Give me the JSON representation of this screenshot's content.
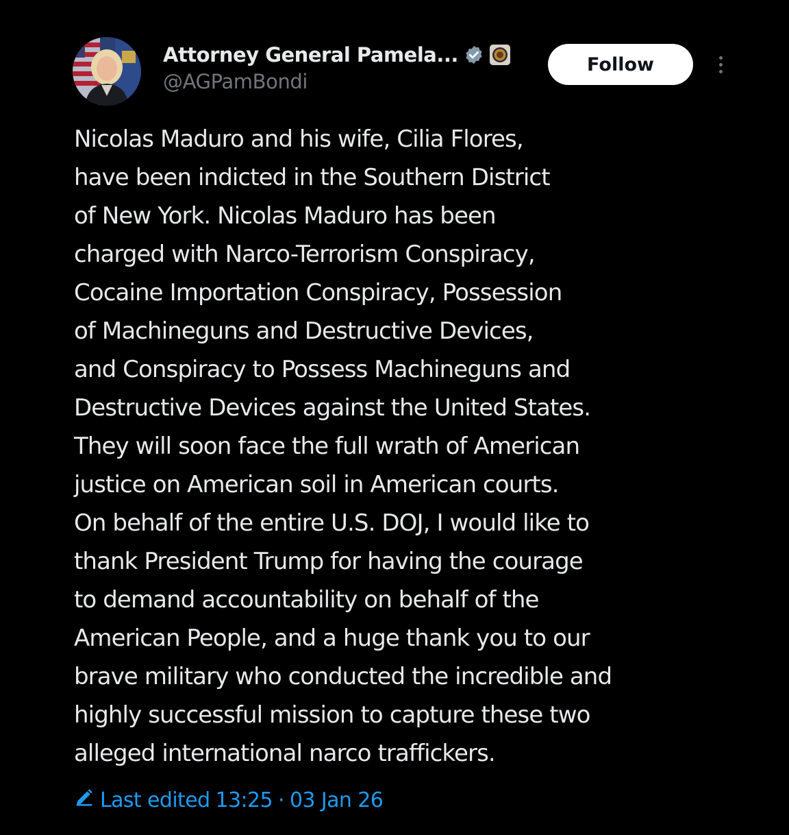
{
  "author": {
    "display_name": "Attorney General Pamela...",
    "handle": "@AGPamBondi",
    "verified_badge_icon": "verified-badge-icon",
    "affiliate_icon": "doj-seal-icon",
    "verified_color": "#1d9bf0"
  },
  "follow_button": {
    "label": "Follow"
  },
  "more_menu_icon": "more-vertical-icon",
  "tweet": {
    "lines": [
      "Nicolas Maduro and his wife, Cilia Flores,",
      "have been indicted in the Southern District",
      "of New York.  Nicolas Maduro has been",
      "charged with Narco-Terrorism Conspiracy,",
      "Cocaine Importation Conspiracy, Possession",
      "of Machineguns and Destructive Devices,",
      "and Conspiracy to Possess Machineguns and",
      "Destructive Devices against the United States.",
      "They will soon face the full wrath of American",
      "justice on American soil in American courts.",
      "On behalf of the entire U.S. DOJ, I would like to",
      "thank President Trump for having the courage",
      "to demand accountability on behalf of the",
      "American People, and a huge thank you to our",
      "brave military who conducted the incredible and",
      "highly successful mission to capture these two",
      "alleged international narco traffickers."
    ]
  },
  "edited": {
    "icon": "edit-pencil-icon",
    "label": "Last edited",
    "time": "13:25",
    "separator": "·",
    "date": "03 Jan 26"
  },
  "colors": {
    "background": "#000000",
    "text": "#e7e9ea",
    "secondary_text": "#71767b",
    "accent": "#1d9bf0"
  }
}
